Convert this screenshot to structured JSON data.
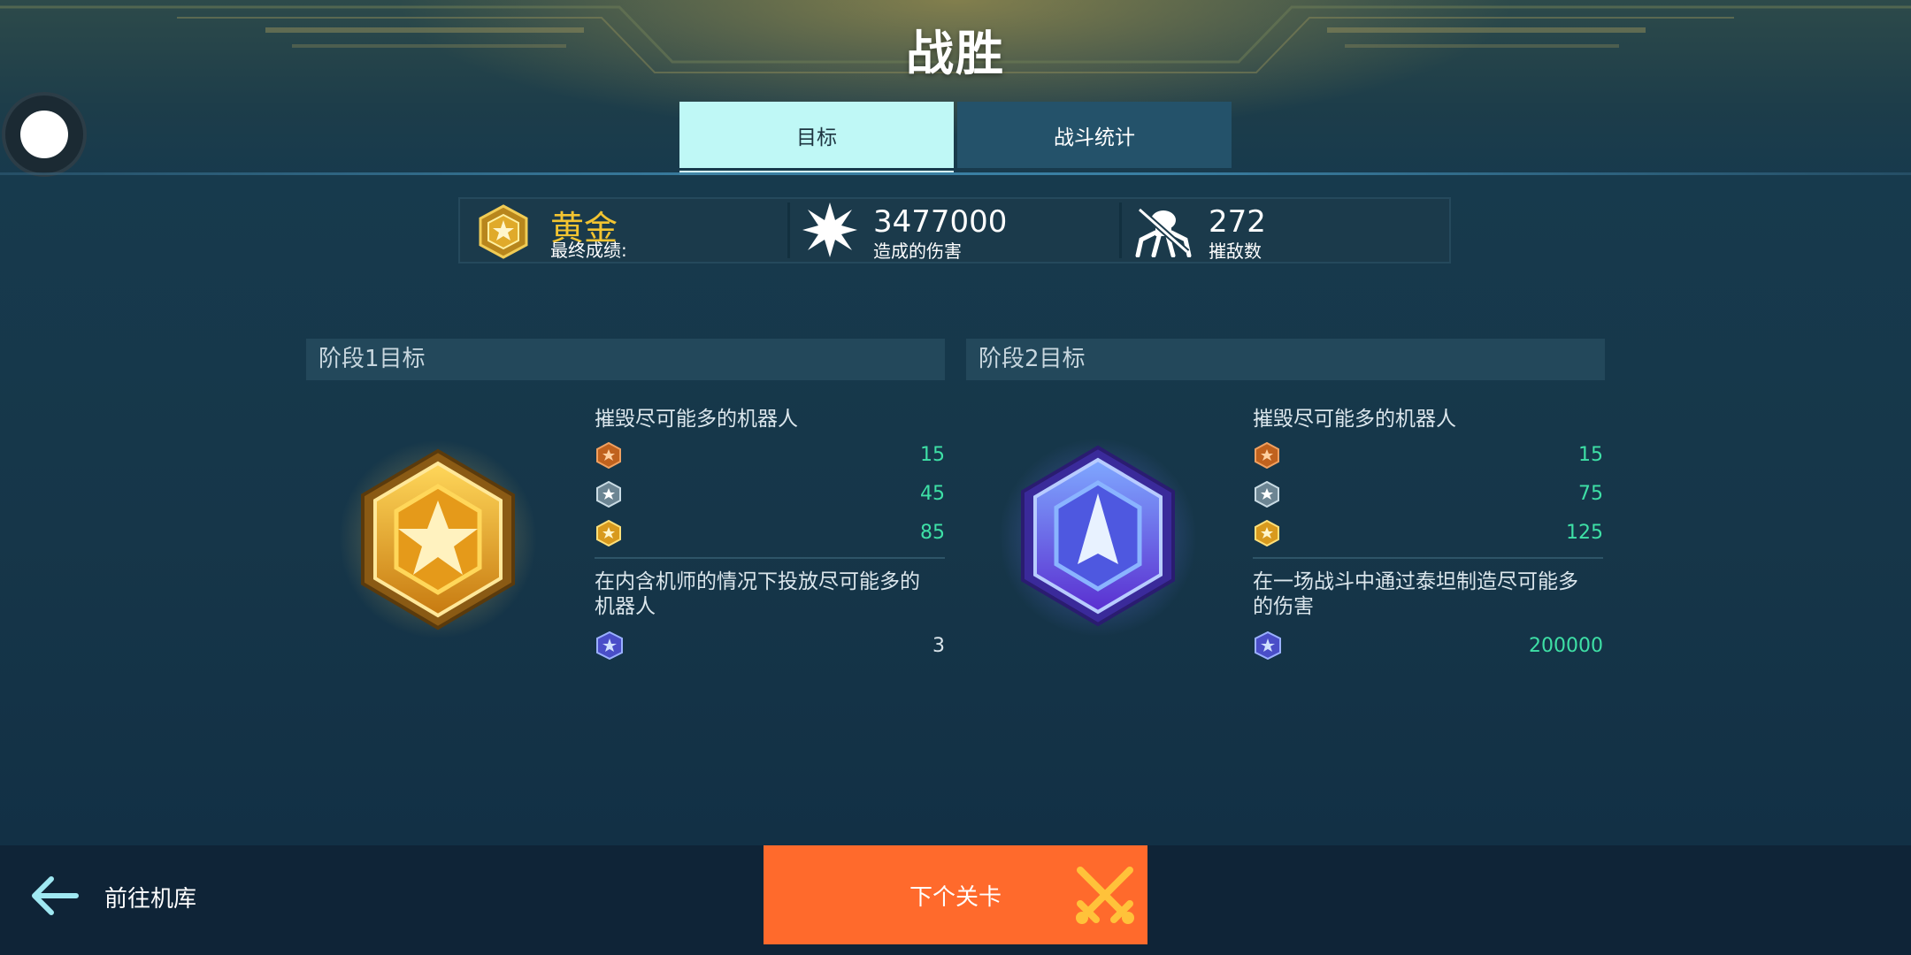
{
  "header": {
    "title": "战胜"
  },
  "tabs": [
    {
      "label": "目标",
      "active": true
    },
    {
      "label": "战斗统计",
      "active": false
    }
  ],
  "stats": {
    "grade": {
      "value": "黄金",
      "label": "最终成绩:"
    },
    "damage": {
      "value": "3477000",
      "label": "造成的伤害"
    },
    "kills": {
      "value": "272",
      "label": "摧敌数"
    }
  },
  "stages": [
    {
      "title": "阶段1目标",
      "medal": "gold",
      "goal1": {
        "text": "摧毁尽可能多的机器人",
        "tiers": [
          {
            "icon": "bronze-medal-icon",
            "value": "15"
          },
          {
            "icon": "silver-medal-icon",
            "value": "45"
          },
          {
            "icon": "gold-medal-icon",
            "value": "85"
          }
        ]
      },
      "goal2": {
        "text": "在内含机师的情况下投放尽可能多的机器人",
        "line1": "在内含机师的情况下投放尽可能多的",
        "line2": "机器人",
        "value": "3",
        "icon": "platinum-medal-icon"
      }
    },
    {
      "title": "阶段2目标",
      "medal": "platinum",
      "goal1": {
        "text": "摧毁尽可能多的机器人",
        "tiers": [
          {
            "icon": "bronze-medal-icon",
            "value": "15"
          },
          {
            "icon": "silver-medal-icon",
            "value": "75"
          },
          {
            "icon": "gold-medal-icon",
            "value": "125"
          }
        ]
      },
      "goal2": {
        "text": "在一场战斗中通过泰坦制造尽可能多的伤害",
        "line1": "在一场战斗中通过泰坦制造尽可能多",
        "line2": "的伤害",
        "value": "200000",
        "icon": "platinum-medal-icon"
      }
    }
  ],
  "footer": {
    "back_label": "前往机库",
    "next_label": "下个关卡"
  },
  "colors": {
    "accent_tab": "#bff8f6",
    "gold": "#f3c431",
    "value_green": "#3ee0a6",
    "next_button": "#ff6a2c"
  }
}
